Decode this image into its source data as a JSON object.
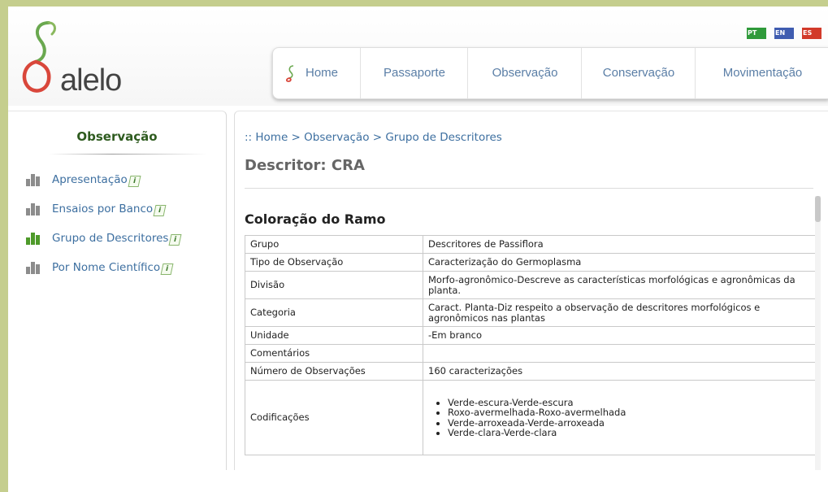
{
  "logo": {
    "text": "alelo"
  },
  "flags": [
    {
      "code": "PT",
      "color": "#2f9a3a"
    },
    {
      "code": "EN",
      "color": "#3f5cb0"
    },
    {
      "code": "ES",
      "color": "#d23a2a"
    }
  ],
  "nav": {
    "items": [
      {
        "label": "Home"
      },
      {
        "label": "Passaporte"
      },
      {
        "label": "Observação"
      },
      {
        "label": "Conservação"
      },
      {
        "label": "Movimentação"
      }
    ]
  },
  "sidebar": {
    "title": "Observação",
    "items": [
      {
        "label": "Apresentação",
        "active": false
      },
      {
        "label": "Ensaios por Banco",
        "active": false
      },
      {
        "label": "Grupo de Descritores",
        "active": true
      },
      {
        "label": "Por Nome Científico",
        "active": false
      }
    ]
  },
  "breadcrumb": ":: Home > Observação > Grupo de Descritores",
  "descriptor_title": "Descritor: CRA",
  "section_title": "Coloração do Ramo",
  "table": {
    "rows": [
      {
        "key": "Grupo",
        "value": "Descritores de Passiflora"
      },
      {
        "key": "Tipo de Observação",
        "value": "Caracterização do Germoplasma"
      },
      {
        "key": "Divisão",
        "value": "Morfo-agronômico-Descreve as características morfológicas e agronômicas da planta."
      },
      {
        "key": "Categoria",
        "value": "Caract. Planta-Diz respeito a observação de descritores morfológicos e agronômicos nas plantas"
      },
      {
        "key": "Unidade",
        "value": "-Em branco"
      },
      {
        "key": "Comentários",
        "value": ""
      },
      {
        "key": "Número de Observações",
        "value": "160 caracterizações"
      }
    ],
    "codificacoes": {
      "key": "Codificações",
      "items": [
        "Verde-escura-Verde-escura",
        "Roxo-avermelhada-Roxo-avermelhada",
        "Verde-arroxeada-Verde-arroxeada",
        "Verde-clara-Verde-clara"
      ]
    }
  },
  "colors": {
    "background": "#c5ce8e",
    "link": "#3d6fa0",
    "sidebar_title": "#2e5b1f",
    "bar_inactive": "#8c8c8c",
    "bar_active": "#4e9a2a"
  }
}
